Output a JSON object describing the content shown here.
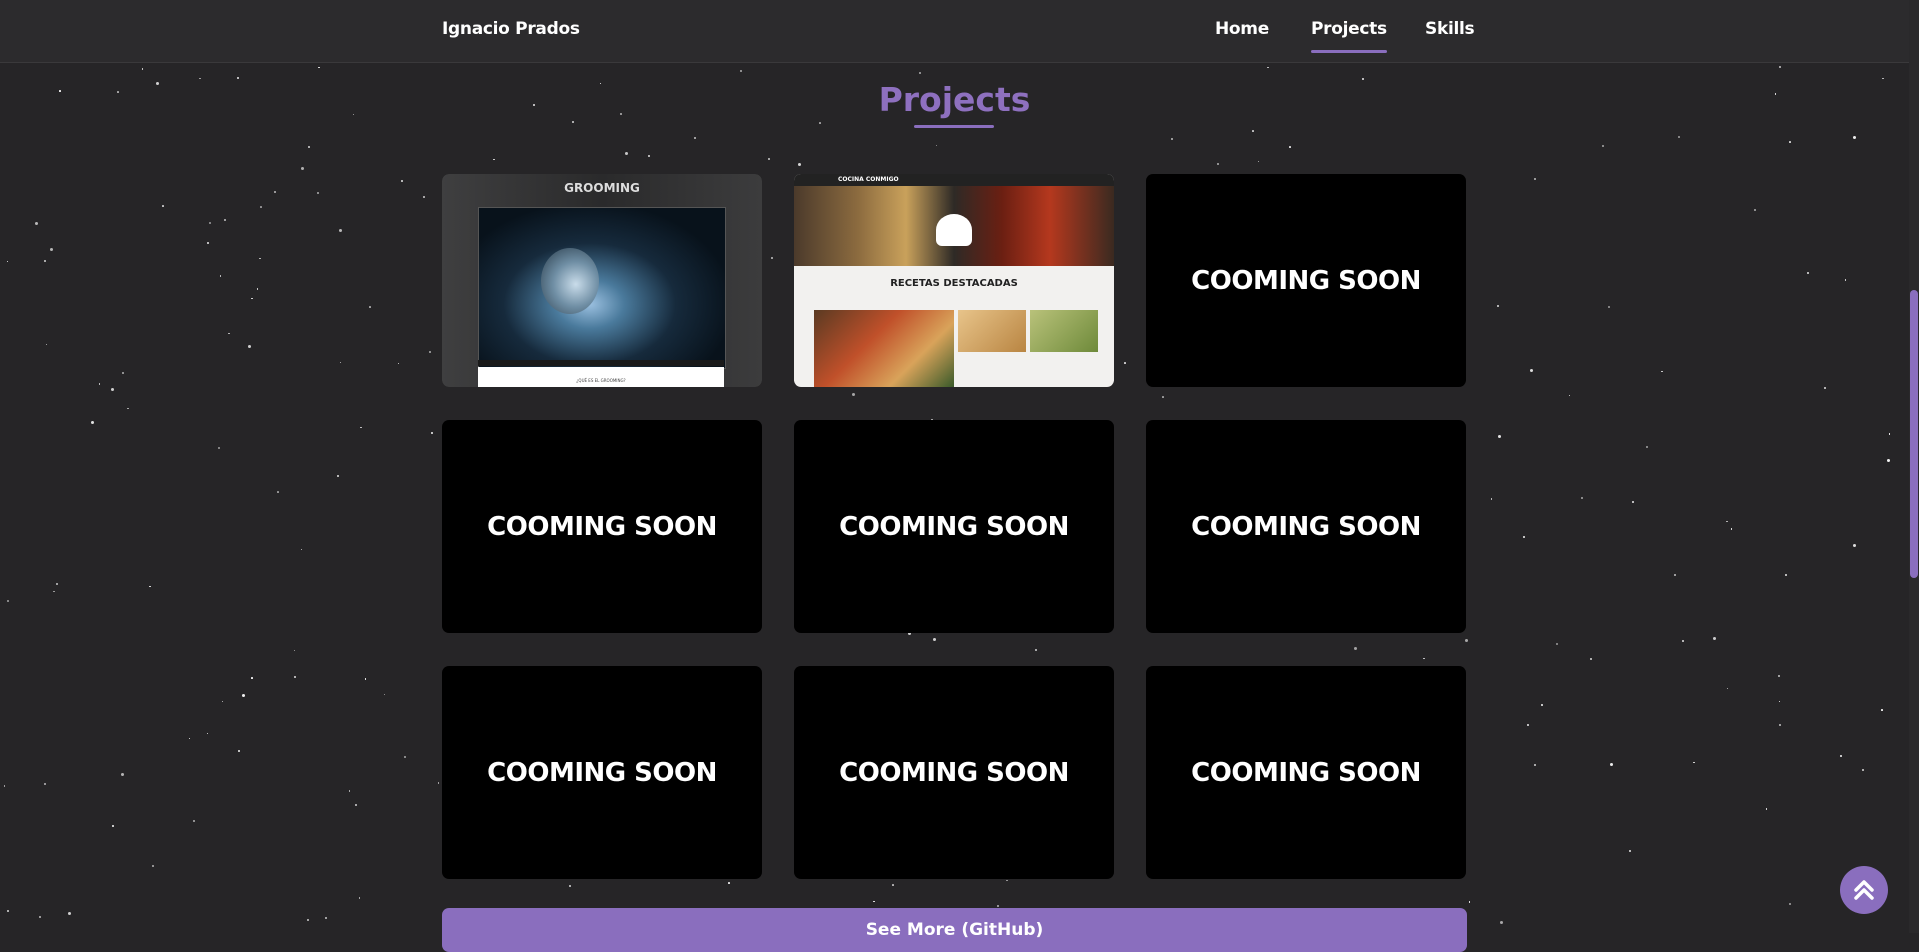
{
  "header": {
    "brand": "Ignacio Prados",
    "nav": [
      {
        "label": "Home"
      },
      {
        "label": "Projects",
        "active": true
      },
      {
        "label": "Skills"
      }
    ]
  },
  "section": {
    "title": "Projects"
  },
  "projects": [
    {
      "type": "thumbnail",
      "site_title": "GROOMING",
      "site_subtitle": "¿QUÉ ES EL GROOMING?"
    },
    {
      "type": "thumbnail",
      "site_brand": "COCINA CONMIGO",
      "site_heading": "RECETAS DESTACADAS"
    },
    {
      "type": "placeholder",
      "label": "COOMING SOON"
    },
    {
      "type": "placeholder",
      "label": "COOMING SOON"
    },
    {
      "type": "placeholder",
      "label": "COOMING SOON"
    },
    {
      "type": "placeholder",
      "label": "COOMING SOON"
    },
    {
      "type": "placeholder",
      "label": "COOMING SOON"
    },
    {
      "type": "placeholder",
      "label": "COOMING SOON"
    },
    {
      "type": "placeholder",
      "label": "COOMING SOON"
    }
  ],
  "see_more": {
    "label": "See More (GitHub)"
  },
  "scroll_top": {
    "icon": "double-chevron-up-icon"
  },
  "colors": {
    "accent": "#8a6ebe",
    "background": "#262527",
    "header": "#2c2b2d"
  }
}
